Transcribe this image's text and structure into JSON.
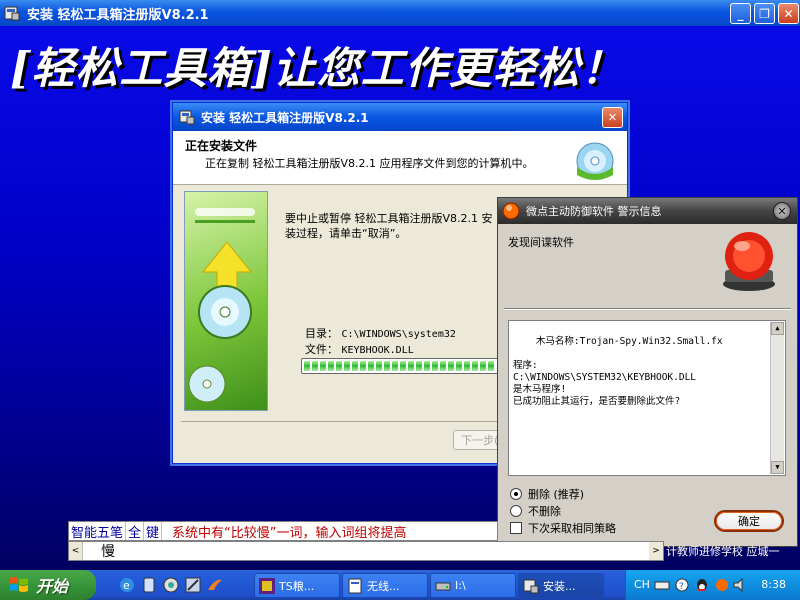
{
  "app": {
    "title": "安装  轻松工具箱注册版V8.2.1",
    "minimize": "_",
    "restore": "❐",
    "close": "✕"
  },
  "banner": {
    "title": "[轻松工具箱]让您工作更轻松！"
  },
  "setup_dialog": {
    "title": "安装  轻松工具箱注册版V8.2.1",
    "close": "✕",
    "header_title": "正在安装文件",
    "header_subtitle": "正在复制 轻松工具箱注册版V8.2.1 应用程序文件到您的计算机中。",
    "message": "要中止或暂停 轻松工具箱注册版V8.2.1 安装过程，请单击“取消”。",
    "dir_label": "目录：",
    "dir_value": "C:\\WINDOWS\\system32",
    "file_label": "文件：",
    "file_value": "KEYBHOOK.DLL",
    "next_button": "下一步(N)",
    "progress": 0.95
  },
  "alert_dialog": {
    "title": "微点主动防御软件  警示信息",
    "close": "✕",
    "found_text": "发现间谍软件",
    "details": "木马名称:Trojan-Spy.Win32.Small.fx\n\n程序:\nC:\\WINDOWS\\SYSTEM32\\KEYBHOOK.DLL\n是木马程序!\n已成功阻止其运行，是否要删除此文件?",
    "option_delete": "删除 (推荐)",
    "option_keep": "不删除",
    "option_same_policy": "下次采取相同策略",
    "selected_option": "delete",
    "ok_button": "确定"
  },
  "ime": {
    "mode_name": "智能五笔",
    "mode_full": "全",
    "mode_key": "键",
    "hint": "系统中有“比较慢”一词，输入词组将提高",
    "input_word": "慢",
    "overflow_text": "计教师进修学校 应城一"
  },
  "taskbar": {
    "start_label": "开始",
    "tasks": [
      {
        "label": "TS粮..."
      },
      {
        "label": "无线..."
      },
      {
        "label": "I:\\"
      },
      {
        "label": "安装..."
      }
    ],
    "tray_lang": "CH",
    "clock": "8:38"
  },
  "colors": {
    "desktop_blue": "#0000c8",
    "xp_title_blue": "#0a54e0",
    "start_green": "#37963a",
    "tray_blue": "#0f8ee0",
    "alert_red": "#e02010"
  }
}
